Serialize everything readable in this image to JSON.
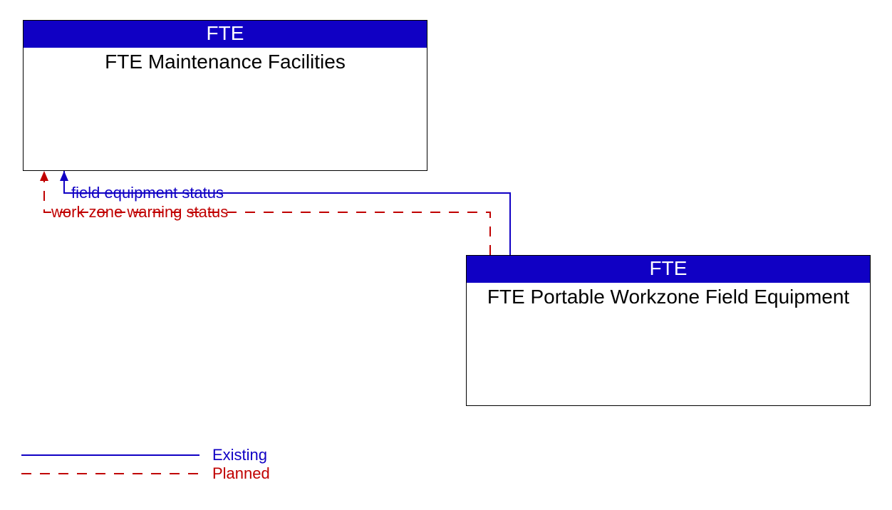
{
  "colors": {
    "existing": "#1000c4",
    "planned": "#c00000",
    "header_bg": "#1000c4",
    "header_fg": "#ffffff"
  },
  "entities": {
    "top_left": {
      "header": "FTE",
      "body": "FTE Maintenance Facilities"
    },
    "bottom_right": {
      "header": "FTE",
      "body": "FTE Portable Workzone Field Equipment"
    }
  },
  "flows": {
    "existing_label": "field equipment status",
    "planned_label": "work zone warning status"
  },
  "legend": {
    "existing": "Existing",
    "planned": "Planned"
  }
}
